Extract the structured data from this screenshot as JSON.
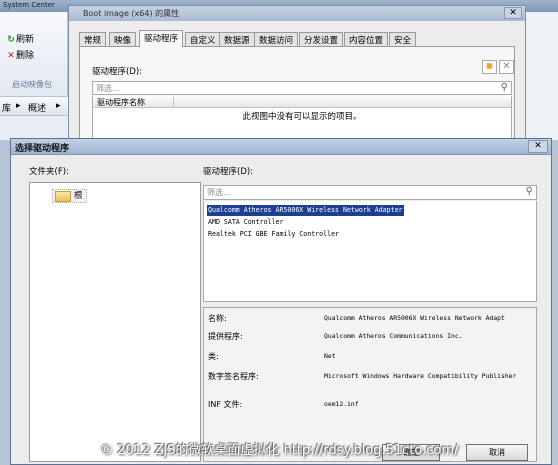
{
  "console": {
    "title": "System Center",
    "refresh_label": "刷新",
    "delete_label": "删除",
    "group_label": "启动映像包",
    "nav_root": "库",
    "nav_overview": "概述"
  },
  "properties_dialog": {
    "title": "Boot image (x64) 的属性",
    "tabs": [
      "常规",
      "映像",
      "驱动程序",
      "自定义",
      "数据源",
      "数据访问",
      "分发设置",
      "内容位置",
      "安全"
    ],
    "active_tab_index": 2,
    "drivers_label": "驱动程序(D):",
    "filter_placeholder": "筛选...",
    "column_driver_name": "驱动程序名称",
    "empty_message": "此视图中没有可以显示的项目。"
  },
  "select_driver_dialog": {
    "title": "选择驱动程序",
    "folders_label": "文件夹(F):",
    "root_folder": "根",
    "drivers_label": "驱动程序(D):",
    "filter_placeholder": "筛选...",
    "drivers": [
      "Qualcomm Atheros AR5006X Wireless Network Adapter",
      "AMD SATA Controller",
      "Realtek PCI GBE Family Controller"
    ],
    "selected_driver_index": 0,
    "details": {
      "name_label": "名称:",
      "name_value": "Qualcomm Atheros AR5006X Wireless Network Adapt",
      "provider_label": "提供程序:",
      "provider_value": "Qualcomm Atheros Communications Inc.",
      "class_label": "类:",
      "class_value": "Net",
      "signer_label": "数字签名程序:",
      "signer_value": "Microsoft Windows Hardware Compatibility Publisher",
      "inf_label": "INF 文件:",
      "inf_value": "oem12.inf"
    },
    "ok_label": "确定",
    "cancel_label": "取消"
  },
  "watermark": "© 2012 ZJS的微软桌面虚拟化 http://rdsy.blog.51cto.com/"
}
